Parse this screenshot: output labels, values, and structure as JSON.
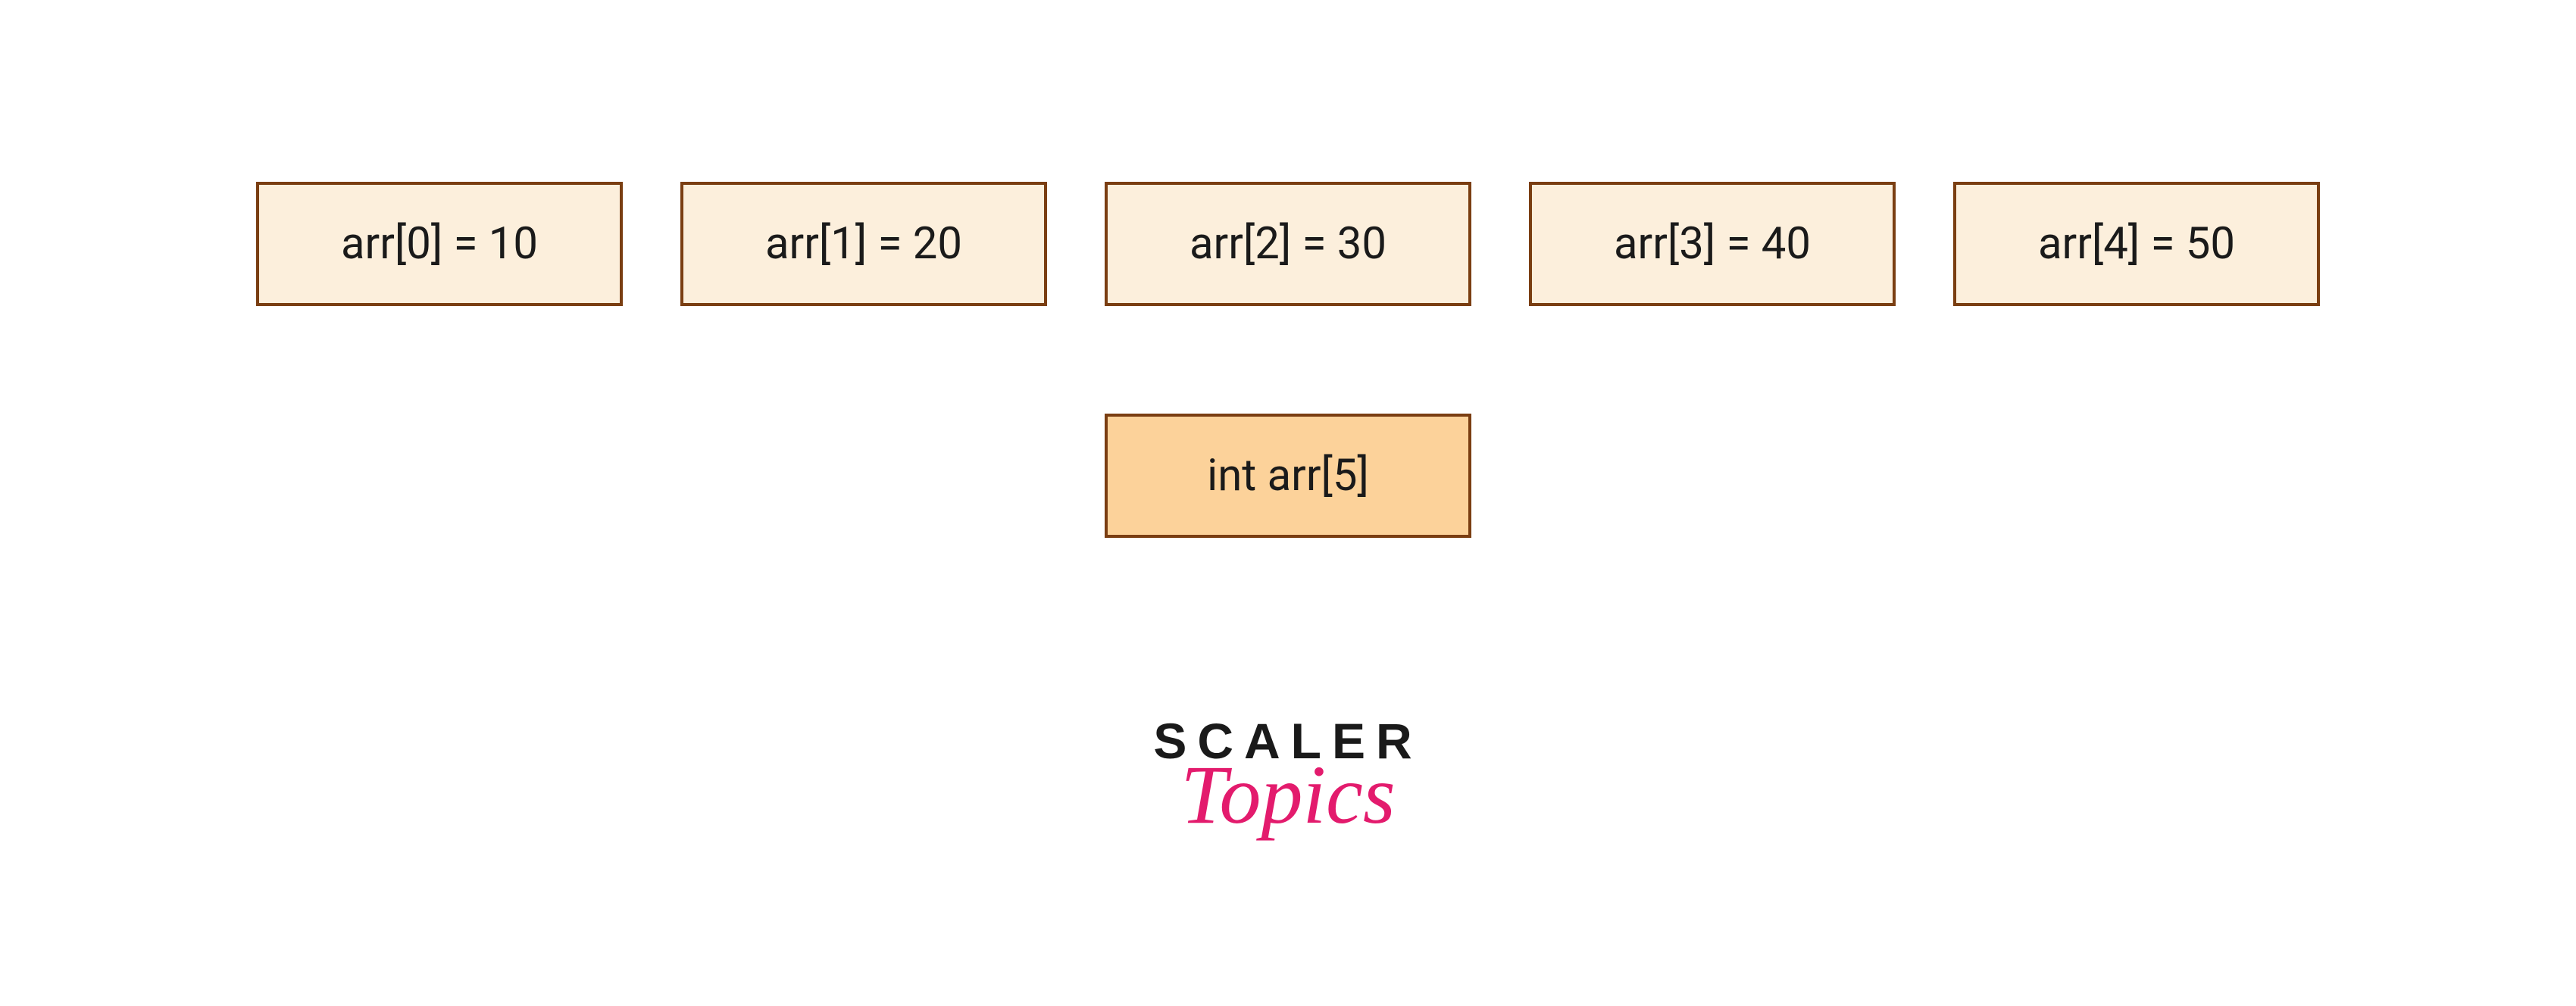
{
  "array": {
    "cells": [
      {
        "label": "arr[0] = 10"
      },
      {
        "label": "arr[1] = 20"
      },
      {
        "label": "arr[2] = 30"
      },
      {
        "label": "arr[3] = 40"
      },
      {
        "label": "arr[4] = 50"
      }
    ],
    "declaration": "int arr[5]"
  },
  "logo": {
    "line1": "SCALER",
    "line2": "Topics"
  },
  "colors": {
    "cell_bg": "#fcefdc",
    "cell_border": "#7a3e12",
    "declaration_bg": "#fcd29a",
    "logo_accent": "#e31b6d"
  }
}
